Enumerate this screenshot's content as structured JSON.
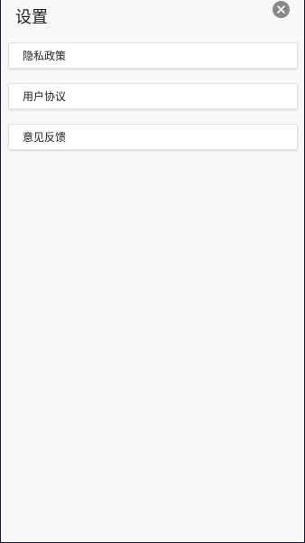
{
  "header": {
    "title": "设置",
    "close_icon": "close-icon"
  },
  "menu": {
    "items": [
      {
        "label": "隐私政策"
      },
      {
        "label": "用户协议"
      },
      {
        "label": "意见反馈"
      }
    ]
  },
  "colors": {
    "background": "#f8f8f9",
    "card": "#ffffff",
    "close_button": "#888888",
    "text": "#222222"
  }
}
